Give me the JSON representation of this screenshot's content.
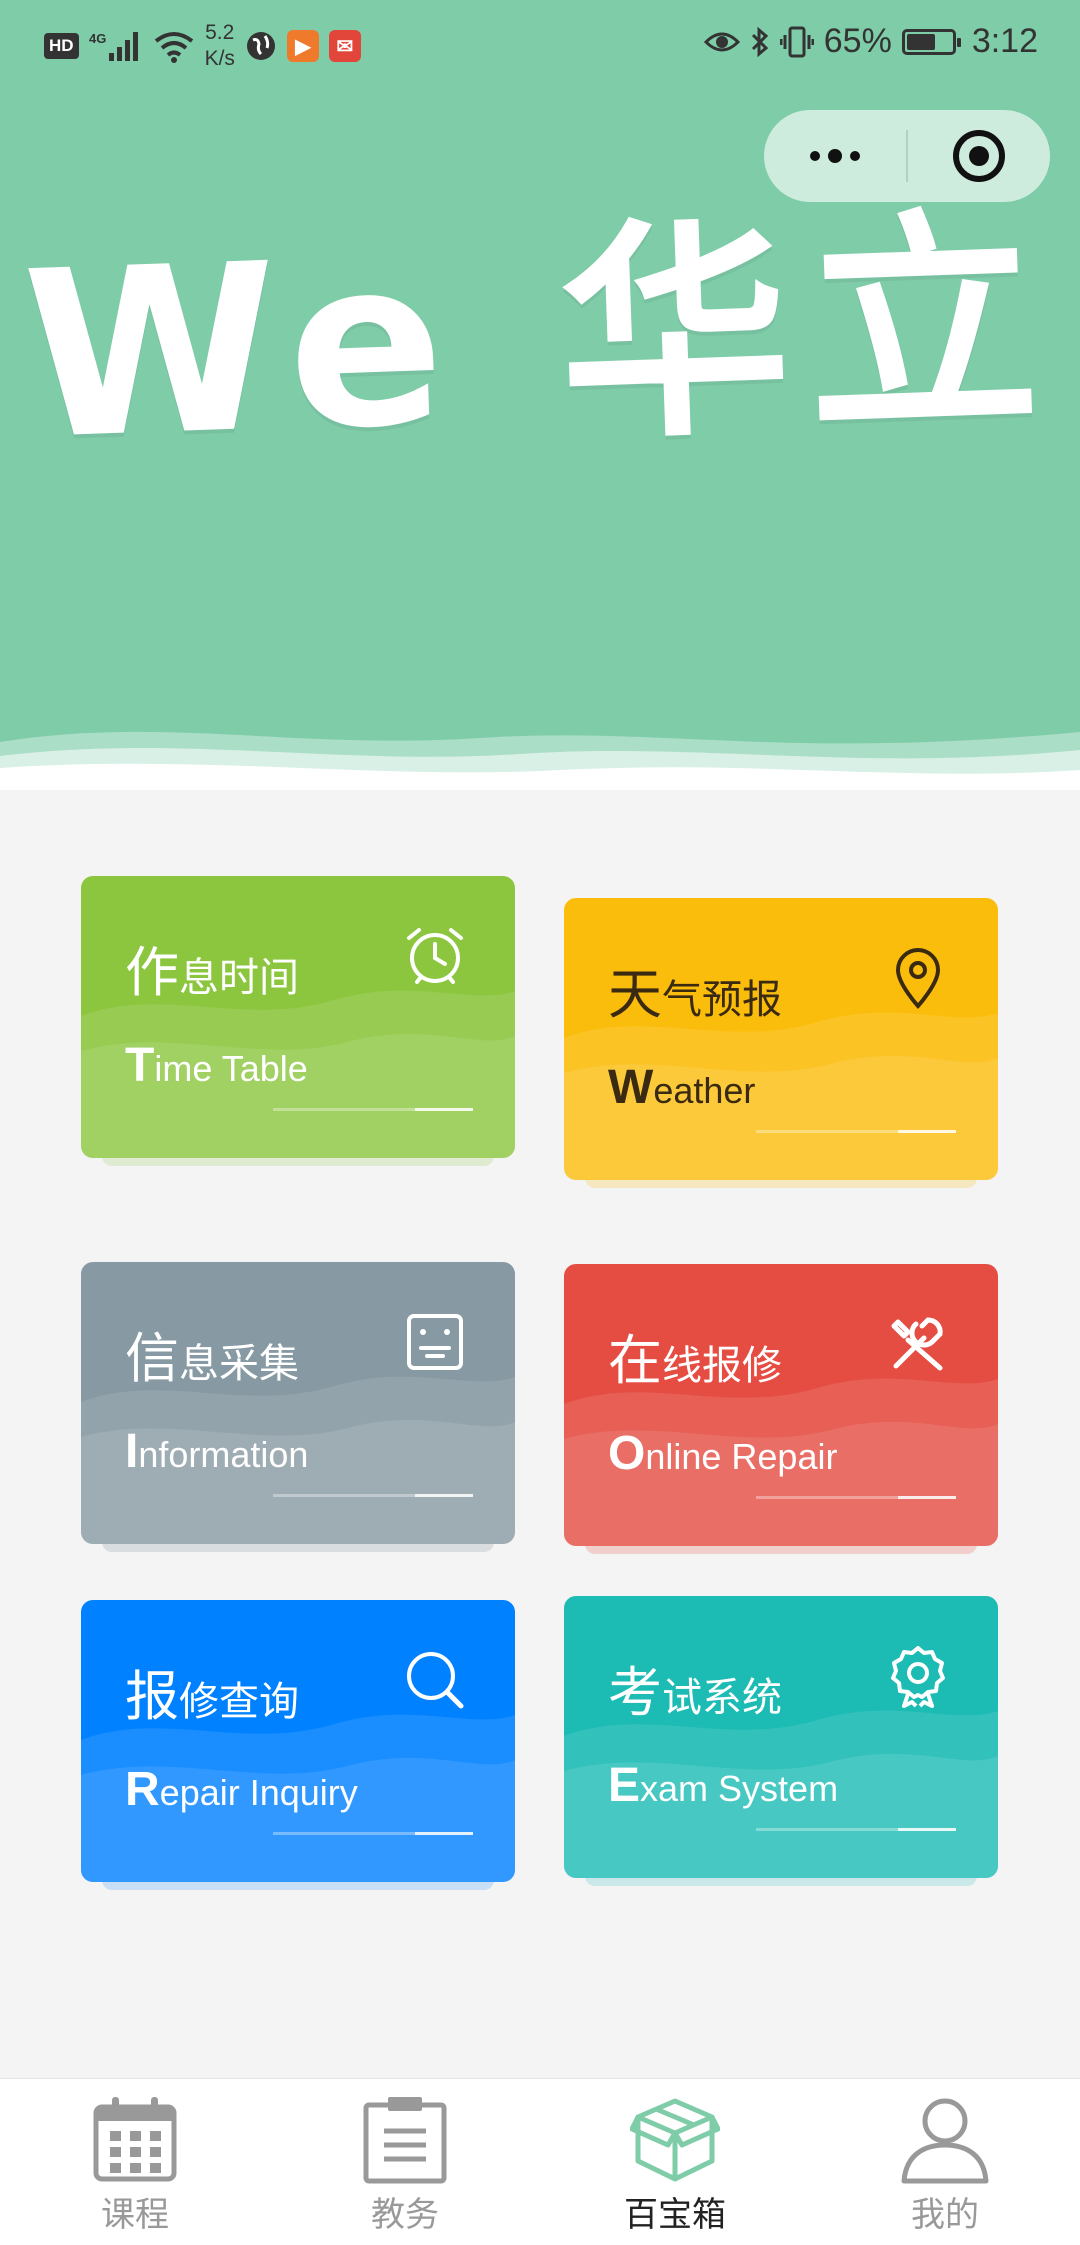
{
  "status_bar": {
    "hd": "HD",
    "network": "4G",
    "speed_value": "5.2",
    "speed_unit": "K/s",
    "battery_percent": "65%",
    "battery_level": 0.65,
    "time": "3:12"
  },
  "header": {
    "title": "We 华立",
    "background_color": "#7fcca9"
  },
  "cards": [
    {
      "cn_first": "作",
      "cn_rest": "息时间",
      "en_first": "T",
      "en_rest": "ime Table",
      "icon": "alarm-clock-icon",
      "color": "#8cc63f"
    },
    {
      "cn_first": "天",
      "cn_rest": "气预报",
      "en_first": "W",
      "en_rest": "eather",
      "icon": "location-pin-icon",
      "color": "#fbbd0c"
    },
    {
      "cn_first": "信",
      "cn_rest": "息采集",
      "en_first": "I",
      "en_rest": "nformation",
      "icon": "info-form-icon",
      "color": "#8799a3"
    },
    {
      "cn_first": "在",
      "cn_rest": "线报修",
      "en_first": "O",
      "en_rest": "nline Repair",
      "icon": "tools-icon",
      "color": "#e54d42"
    },
    {
      "cn_first": "报",
      "cn_rest": "修查询",
      "en_first": "R",
      "en_rest": "epair Inquiry",
      "icon": "search-icon",
      "color": "#0081ff"
    },
    {
      "cn_first": "考",
      "cn_rest": "试系统",
      "en_first": "E",
      "en_rest": "xam System",
      "icon": "badge-icon",
      "color": "#1cbbb4"
    }
  ],
  "tabbar": {
    "items": [
      {
        "label": "课程",
        "icon": "calendar-icon",
        "active": false
      },
      {
        "label": "教务",
        "icon": "clipboard-icon",
        "active": false
      },
      {
        "label": "百宝箱",
        "icon": "box-icon",
        "active": true
      },
      {
        "label": "我的",
        "icon": "user-icon",
        "active": false
      }
    ],
    "active_color": "#7fcca9"
  }
}
